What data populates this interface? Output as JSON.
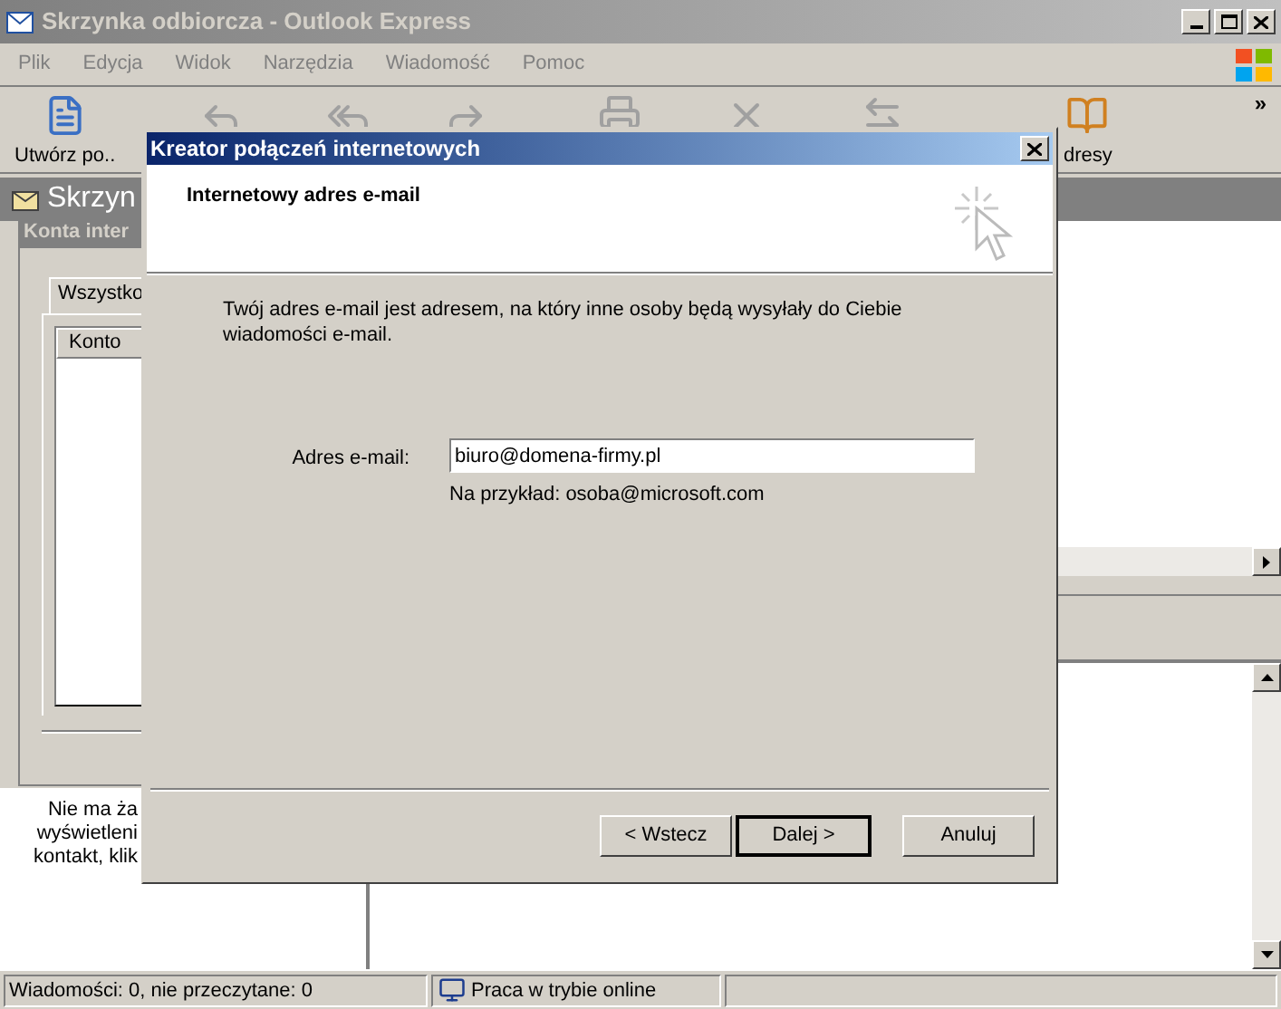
{
  "window": {
    "title": "Skrzynka odbiorcza - Outlook Express"
  },
  "menu": [
    "Plik",
    "Edycja",
    "Widok",
    "Narzędzia",
    "Wiadomość",
    "Pomoc"
  ],
  "toolbar": [
    {
      "kind": "new",
      "label": "Utwórz po..",
      "disabled": false
    },
    {
      "kind": "reply",
      "disabled": true
    },
    {
      "kind": "reply_all",
      "disabled": true
    },
    {
      "kind": "forward",
      "disabled": true
    },
    {
      "kind": "print",
      "disabled": true
    },
    {
      "kind": "delete",
      "disabled": true
    },
    {
      "kind": "send_receive",
      "disabled": true
    },
    {
      "kind": "addresses",
      "label": "dresy",
      "disabled": false
    }
  ],
  "toolbar_overflow": "»",
  "folder_header": {
    "title": "Skrzyn"
  },
  "accounts_dialog": {
    "title": "Konta inter",
    "tabs": [
      {
        "label": "Wszystko",
        "selected": true
      }
    ],
    "columns": [
      "Konto"
    ]
  },
  "contacts": {
    "message_lines": [
      "Nie ma ża",
      "wyświetleni",
      "kontakt, klik"
    ]
  },
  "wizard": {
    "title": "Kreator połączeń internetowych",
    "heading": "Internetowy adres e-mail",
    "description": "Twój adres e-mail jest adresem, na który inne osoby będą wysyłały do Ciebie wiadomości e-mail.",
    "field_label": "Adres e-mail:",
    "field_value": "biuro@domena-firmy.pl",
    "hint": "Na przykład: osoba@microsoft.com",
    "buttons": [
      {
        "label": "< Wstecz",
        "default": false
      },
      {
        "label": "Dalej >",
        "default": true
      },
      {
        "label": "Anuluj",
        "default": false
      }
    ]
  },
  "status_bar": {
    "messages": "Wiadomości: 0, nie przeczytane: 0",
    "connection": "Praca w trybie online"
  }
}
